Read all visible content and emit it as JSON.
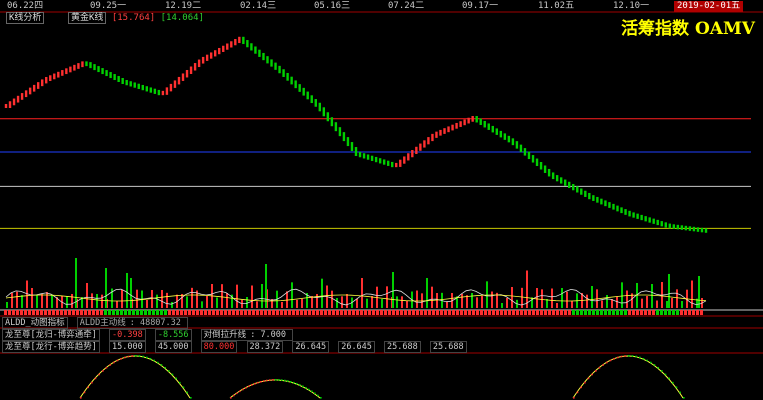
{
  "date_ticks": [
    {
      "label": "06.22四",
      "id": "0622"
    },
    {
      "label": "09.25一",
      "id": "0925"
    },
    {
      "label": "12.19二",
      "id": "1219"
    },
    {
      "label": "02.14三",
      "id": "0214"
    },
    {
      "label": "05.16三",
      "id": "0516"
    },
    {
      "label": "07.24二",
      "id": "0724"
    },
    {
      "label": "09.17一",
      "id": "0917"
    },
    {
      "label": "11.02五",
      "id": "1102"
    },
    {
      "label": "12.10一",
      "id": "1210"
    }
  ],
  "selected_date": "2019-02-01五",
  "title": "活筹指数 OAMV",
  "tabs": {
    "kline": "K线分析",
    "golden": "黄金K线",
    "val1": "15.764",
    "val2": "14.064"
  },
  "indicator1": {
    "name": "ALDD_动图指标",
    "label": "ALDD主动线",
    "value": "48807.32"
  },
  "indicator2": {
    "name": "龙至尊[龙归-博弈通牵]",
    "v1": "-0.398",
    "v2": "-8.556",
    "extra": "对倒拉升线",
    "extra_val": "7.000"
  },
  "indicator3": {
    "name": "龙至尊[龙行-博弈趋势]",
    "values": [
      "15.000",
      "45.000",
      "80.000",
      "28.372",
      "26.645",
      "26.645",
      "25.688",
      "25.688"
    ]
  },
  "colors": {
    "up": "#ff3030",
    "down": "#00d000",
    "hline_red": "#ff2020",
    "hline_blue": "#2040ff",
    "hline_white": "#c8c8c8",
    "hline_yellow": "#c8c800",
    "title": "#ffff00"
  },
  "chart_data": {
    "type": "line",
    "price_path": [
      8.5,
      9.6,
      10.3,
      9.5,
      9.0,
      10.4,
      11.3,
      10.0,
      8.5,
      6.5,
      6.0,
      7.3,
      8.0,
      7.0,
      5.6,
      4.7,
      4.0,
      3.5,
      3.3
    ],
    "horizontal_levels": [
      8.3,
      7.0,
      5.4,
      3.4
    ],
    "volume": [
      12,
      18,
      14,
      22,
      30,
      16,
      20,
      14,
      12,
      18,
      10,
      24,
      14,
      12,
      16,
      12,
      20,
      22,
      14,
      10
    ]
  }
}
